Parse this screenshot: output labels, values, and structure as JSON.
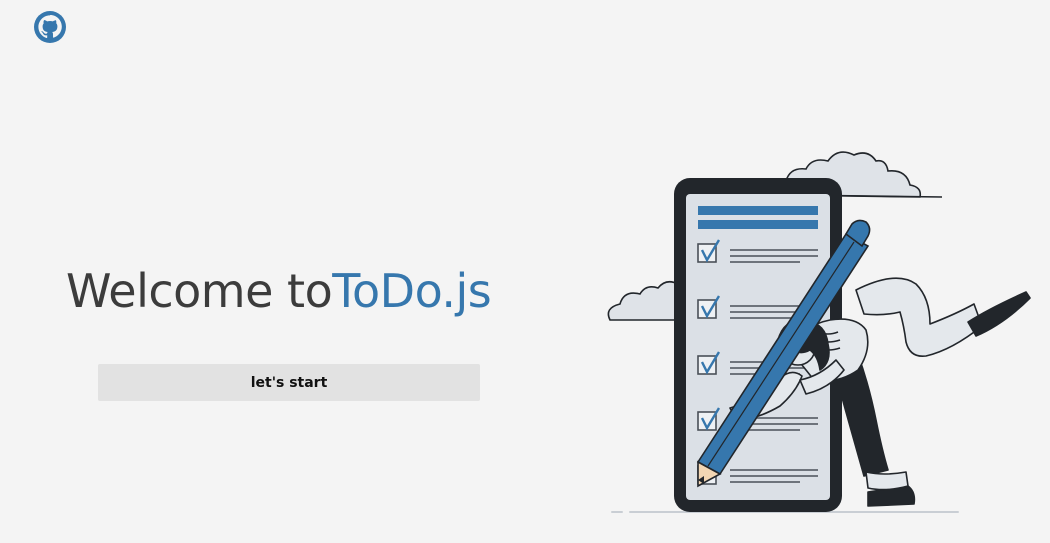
{
  "header": {
    "github_icon": "github-icon"
  },
  "hero": {
    "title_prefix": "Welcome to",
    "title_brand": "ToDo.js",
    "start_label": "let's start"
  },
  "illustration": {
    "subject": "woman holding pencil beside phone checklist"
  },
  "colors": {
    "background": "#f4f4f4",
    "accent": "#3677ad",
    "text": "#3c3c3c",
    "button_bg": "#e2e2e2",
    "dark": "#22262b"
  }
}
